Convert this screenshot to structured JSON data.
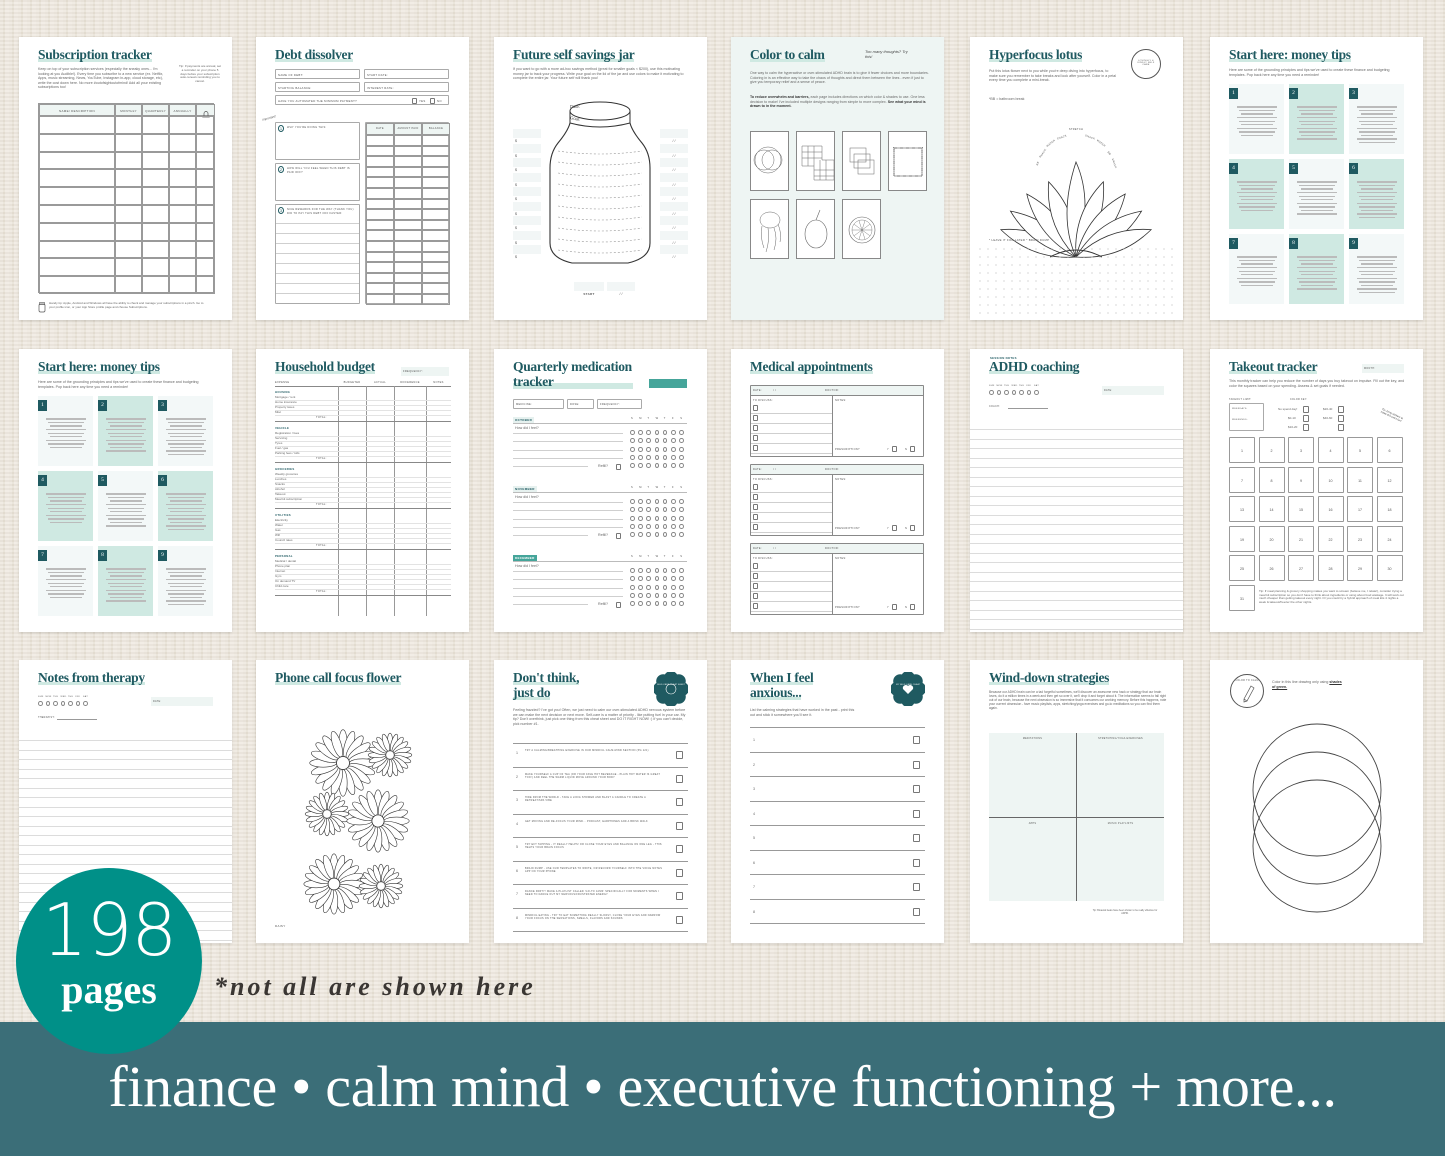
{
  "colors": {
    "brand_teal": "#1f5a61",
    "badge_teal": "#009088",
    "banner": "#3b6e78",
    "mint": "#cfe9e2",
    "pale": "#eef5f3"
  },
  "pages": [
    {
      "type": "subscription",
      "title": "Subscription tracker",
      "intro": "Keep on top of your subscription services (especially the sneaky ones... I'm looking at you Audible!). Every time you subscribe to a new service (ex. Netflix, Apps, music streaming, News, YouTube, Instagram in-app, cloud storage, etc), write the cost down here. No more #outofsightoutofmind! Add all your existing subscriptions too!",
      "tip": "Tip: If payments are annual, set a reminder on your phone 5 days before your subscription auto-renews reminding you to cancel.",
      "columns": [
        "Name/ description",
        "Monthly",
        "Quarterly",
        "Annually"
      ],
      "icon": "bell-icon",
      "footer": "Handy tip: Apple, Android and Windows all have the ability to check and manage your subscriptions in a pinch. Go to your profile icon, or your App Store profile page and choose Subscriptions."
    },
    {
      "type": "debt",
      "title": "Debt dissolver",
      "fields": [
        "Name of debt:",
        "Start date:",
        "Starting balance:",
        "Interest rate:"
      ],
      "question": "Have you automated the minimum payment?",
      "yes": "Yes",
      "no": "No",
      "note": "important!",
      "prompts": [
        "Why you're doing this:",
        "How will you feel when this debt is paid off?",
        "Nice rewards for the way (thank you) did to pay this debt off faster:"
      ],
      "columns": [
        "Date",
        "Amount paid",
        "Balance"
      ]
    },
    {
      "type": "jar",
      "title": "Future self savings jar",
      "intro": "If you want to go with a more ad-hoc savings method (great for smaller goals < $200), use this motivating money jar to track your progress. Write your goal on the lid of the jar and use colors to make it motivating to complete the entire jar. Your future self will thank you!",
      "date": "Date:",
      "goal": "Goal:",
      "currency": "$",
      "date_blank": "/   /",
      "start": "Start"
    },
    {
      "type": "colorcalm",
      "title": "Color to calm",
      "aside": "Too many thoughts? Try this!",
      "intro": "One way to calm the hyperactive or over-stimulated ADHD brain is to give it fewer choices and more boundaries. Coloring in is an effective way to take the chaos of thoughts and direct them between the lines - even if just to give you temporary relief and a sense of peace.",
      "intro2_bold": "To reduce overwhelm and barriers,",
      "intro2": " each page includes directions on which color & shades to use. One less decision to make! I've included multiple designs ranging from simple to more complex. ",
      "intro2_end": "See what your mind is drawn to in the moment."
    },
    {
      "type": "lotus",
      "title": "Hyperfocus lotus",
      "intro": "Put this lotus flower next to you while you're deep diving into hyperfocus, to make sure you remember to take breaks and look after yourself. Color in a petal every time you complete a mini-break.",
      "key": "*BB = bathroom break",
      "stamp": "Lovingly & kindly self care",
      "petals": [
        "BB",
        "Snack",
        "Water",
        "Snack",
        "Stretch",
        "Snack",
        "Water",
        "BB",
        "Snack"
      ],
      "dump": "* Leave it for later * brain dump"
    },
    {
      "type": "tips",
      "title": "Start here: money tips",
      "intro": "Here are some of the grounding principles and tips we've used to create these finance and budgeting templates. Pop back here any time you need a reminder!",
      "numbers": [
        "1",
        "2",
        "3",
        "4",
        "5",
        "6",
        "7",
        "8",
        "9"
      ]
    },
    {
      "type": "tips",
      "title": "Start here: money tips",
      "intro": "Here are some of the grounding principles and tips we've used to create these finance and budgeting templates. Pop back here any time you need a reminder!",
      "numbers": [
        "1",
        "2",
        "3",
        "4",
        "5",
        "6",
        "7",
        "8",
        "9"
      ]
    },
    {
      "type": "budget",
      "title": "Household budget",
      "frequency": "Frequency:",
      "columns": [
        "Expense",
        "Budgeted",
        "Actual",
        "Difference",
        "Notes"
      ],
      "total": "Total:",
      "sections": [
        {
          "name": "Housing",
          "items": [
            "Mortgage / rent",
            "Home insurance",
            "Property taxes",
            "Misc"
          ]
        },
        {
          "name": "Vehicle",
          "items": [
            "Registration / fees",
            "Servicing",
            "Tyres",
            "Fuel / gas",
            "Parking fees / tolls"
          ]
        },
        {
          "name": "Groceries",
          "items": [
            "Weekly groceries",
            "Lunches",
            "Snacks",
            "Alcohol",
            "Takeout",
            "Meal kit subscription"
          ]
        },
        {
          "name": "Utilities",
          "items": [
            "Electricity",
            "Water",
            "Gas",
            "Wifi",
            "Council rates"
          ]
        },
        {
          "name": "Personal",
          "items": [
            "Medical / dental",
            "Phone plan",
            "Internet",
            "Gym",
            "On demand TV",
            "Child care"
          ]
        }
      ]
    },
    {
      "type": "meds",
      "title": "Quarterly medication tracker",
      "badge": "Oct - Dec",
      "fields": [
        "Medicine:",
        "Dose:",
        "Frequency:"
      ],
      "months": [
        "October",
        "November",
        "December"
      ],
      "feel": "How did I feel?",
      "days": [
        "S",
        "M",
        "T",
        "W",
        "T",
        "F",
        "S"
      ],
      "refill": "Refill?"
    },
    {
      "type": "medical",
      "title": "Medical appointments",
      "date": "Date:",
      "slashes": "/     /",
      "doctor": "Doctor:",
      "discuss": "To discuss:",
      "notes": "Notes:",
      "rx": "Prescription?",
      "y": "Y",
      "n": "N"
    },
    {
      "type": "coaching",
      "kicker": "Session notes",
      "title": "ADHD coaching",
      "days": [
        "Sun",
        "Mon",
        "Tue",
        "Wed",
        "Thu",
        "Fri",
        "Sat"
      ],
      "date": "Date:",
      "who": "Coach:"
    },
    {
      "type": "takeout",
      "title": "Takeout tracker",
      "month": "Month:",
      "intro": "This monthly tracker can help you reduce the number of days you buy takeout on impulse. Fill out the key, and color the squares based on your spending. Assess & set goals if needed.",
      "limit": "Takeout limit:",
      "weekdays": "Weekdays:",
      "weekends": "Weekends:",
      "key": "Color key:",
      "keys": [
        "No spend day!",
        "$0-10",
        "$10-20",
        "$20-40",
        "$40-60"
      ],
      "aside": "Tip: bring stickers to make this extra fun!",
      "tip": "Tip: If meal planning & grocery shopping makes you want to scream (believe me, I relate!), consider trying a meal kit subscription so you don't have to think about ingredients or using about food wastage. It will work out much cheaper than getting takeout every night. Or you could try a hybrid approach of meal kits 4 nights a week & takeout/freezer the other nights."
    },
    {
      "type": "coaching",
      "kicker": "",
      "title": "Notes from therapy",
      "days": [
        "Sun",
        "Mon",
        "Tue",
        "Wed",
        "Thu",
        "Fri",
        "Sat"
      ],
      "date": "Date:",
      "who": "Therapist:"
    },
    {
      "type": "flower",
      "title": "Phone call focus flower",
      "caption": "Daisy"
    },
    {
      "type": "checklist",
      "title_lines": [
        "Don't think,",
        "just do"
      ],
      "badge": "Self-care cheat sheet",
      "intro": "Feeling frazzled? I've got you! Often, we just need to calm our over-stimulated ADHD nervous system before we can make the next decision or next move. Self-care is a matter of priority - like putting fuel in your car. My tip? Don't overthink, just pick one thing from this cheat sheet and DO IT RIGHT NOW! :) If you can't decide, pick number #1.",
      "items": [
        "Try a calming/breathing exercise in our mindful calm-mind section (pg 121)",
        "Make yourself a cup of tea (or your fave hot beverage - plain hot water is great too!) and feel the warm liquid move around your body",
        "Hide from the world - take a long shower and blast a candle to create a retreat/spa vibe",
        "Get moving and re-focus your mind... podcast, earphones and a brisk walk",
        "Try EFT tapping - it really helps! Or close your eyes and balance on one leg - this helps your brain focus",
        "Brain dump - use our templates to write, or record yourself into the voice notes app on your phone",
        "Dance party! Make a playlist called 'go-to jams' specifically for moments when I need to dance out my nervous/frustrated energy",
        "Mindful eating - try to eat something really slowly, close your eyes and narrow your focus on the sensations, smells, flavors and sounds"
      ]
    },
    {
      "type": "anxious",
      "title_lines": [
        "When I feel",
        "anxious..."
      ],
      "badge": "My self-care cheat sheet",
      "intro": "List the calming strategies that have worked in the past - print this out and stick it somewhere you'll see it.",
      "numbers": [
        "1",
        "2",
        "3",
        "4",
        "5",
        "6",
        "7",
        "8"
      ]
    },
    {
      "type": "winddown",
      "title": "Wind-down strategies",
      "intro": "Because our ADHD brain can be a tad forgetful sometimes, we'll discover an awesome new hack or strategy that our brain loves, do it a million times in a week and then get so over it, we'll drop it and forget about it. The information seems to fall right out of our brain, because the next obsession is so immersive that it consumes our working memory. Before this happens, note your current obsession - fave music playlists, apps, stretching/yoga exercises and go-to meditations so you can find them again.",
      "quadrants": [
        "Meditations",
        "Stretching/yoga exercises",
        "Apps",
        "Music playlists"
      ],
      "tip": "Tip: Binaural beats have been shown to be really effective for ADHD."
    },
    {
      "type": "circles",
      "stamp": "Color to calm",
      "intro_pre": "Color in this line drawing only using ",
      "intro_em": "shades of green."
    }
  ],
  "badge": {
    "number": "198",
    "label": "pages"
  },
  "note": "*not all are shown here",
  "tagline": "finance • calm mind • executive functioning + more..."
}
